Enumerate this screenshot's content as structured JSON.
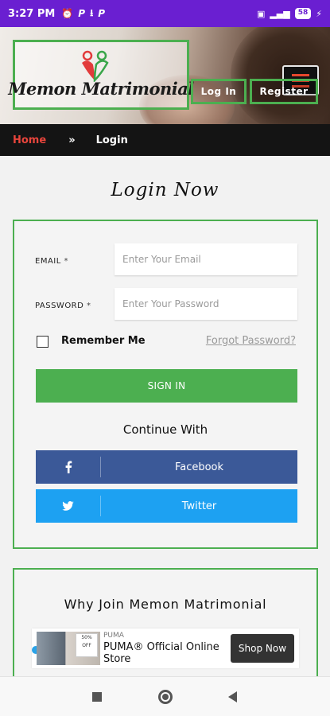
{
  "status_bar": {
    "time": "3:27 PM",
    "left_icons": [
      "alarm-icon",
      "p-icon",
      "download-icon",
      "p-icon"
    ],
    "battery": "58"
  },
  "header": {
    "logo_text": "Memon Matrimonial",
    "login_label": "Log In",
    "register_label": "Register",
    "accent_color": "#4caf50",
    "menu_icon_color": "#e5462d"
  },
  "breadcrumb": {
    "home": "Home",
    "separator": "»",
    "current": "Login"
  },
  "page_title": "Login Now",
  "login_form": {
    "email_label": "EMAIL",
    "email_required": "*",
    "email_placeholder": "Enter Your Email",
    "password_label": "PASSWORD",
    "password_required": "*",
    "password_placeholder": "Enter Your Password",
    "remember_label": "Remember Me",
    "forgot_label": "Forgot Password?",
    "signin_label": "SIGN IN",
    "continue_with": "Continue With",
    "facebook_label": "Facebook",
    "twitter_label": "Twitter"
  },
  "why_join": {
    "title": "Why Join Memon Matrimonial"
  },
  "ad": {
    "brand": "PUMA",
    "headline": "PUMA® Official Online Store",
    "cta": "Shop Now",
    "thumb_text": "50% OFF"
  },
  "nav": {
    "icons": [
      "recents-square-icon",
      "home-circle-icon",
      "back-triangle-icon"
    ]
  }
}
